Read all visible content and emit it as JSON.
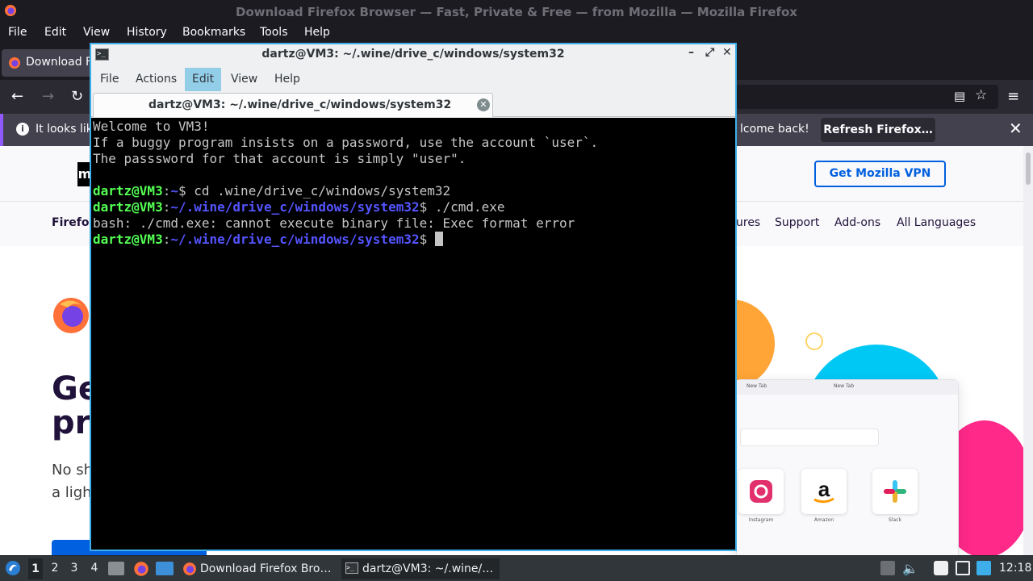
{
  "firefox": {
    "window_title": "Download Firefox Browser — Fast, Private & Free — from Mozilla — Mozilla Firefox",
    "menu": [
      "File",
      "Edit",
      "View",
      "History",
      "Bookmarks",
      "Tools",
      "Help"
    ],
    "tab_label": "Download F",
    "notification": {
      "text_left": "It looks lik",
      "text_right": "lcome back!",
      "refresh_button": "Refresh Firefox…"
    },
    "page": {
      "vpn_button": "Get Mozilla VPN",
      "nav": {
        "brand": "Firefo",
        "items": [
          "ures",
          "Support",
          "Add-ons",
          "All Languages"
        ]
      },
      "hero_title_line1": "Ge",
      "hero_title_line2": "pr",
      "hero_sub_line1": "No sh",
      "hero_sub_line2": "a ligh",
      "mock_tabs": [
        "New Tab",
        "New Tab"
      ],
      "tiles": [
        "Instagram",
        "Amazon",
        "Slack"
      ]
    }
  },
  "terminal": {
    "title": "dartz@VM3: ~/.wine/drive_c/windows/system32",
    "menu": [
      "File",
      "Actions",
      "Edit",
      "View",
      "Help"
    ],
    "active_menu": "Edit",
    "tab_title": "dartz@VM3: ~/.wine/drive_c/windows/system32",
    "lines": [
      {
        "type": "text",
        "text": "Welcome to VM3!"
      },
      {
        "type": "text",
        "text": "If a buggy program insists on a password, use the account `user`."
      },
      {
        "type": "text",
        "text": "The passsword for that account is simply \"user\"."
      },
      {
        "type": "text",
        "text": ""
      },
      {
        "type": "prompt",
        "user": "dartz@VM3",
        "path": "~",
        "cmd": " cd .wine/drive_c/windows/system32"
      },
      {
        "type": "prompt",
        "user": "dartz@VM3",
        "path": "~/.wine/drive_c/windows/system32",
        "cmd": " ./cmd.exe"
      },
      {
        "type": "text",
        "text": "bash: ./cmd.exe: cannot execute binary file: Exec format error"
      },
      {
        "type": "prompt",
        "user": "dartz@VM3",
        "path": "~/.wine/drive_c/windows/system32",
        "cmd": " ",
        "cursor": true
      }
    ]
  },
  "taskbar": {
    "workspaces": [
      "1",
      "2",
      "3",
      "4"
    ],
    "active_workspace": "1",
    "tasks": [
      "Download Firefox Bro…",
      "dartz@VM3: ~/.wine/…"
    ],
    "clock": "12:18"
  },
  "colors": {
    "terminal_border": "#3daee9",
    "prompt_user": "#54ff54",
    "prompt_path": "#5454ff",
    "mozilla_blue": "#0060df"
  }
}
